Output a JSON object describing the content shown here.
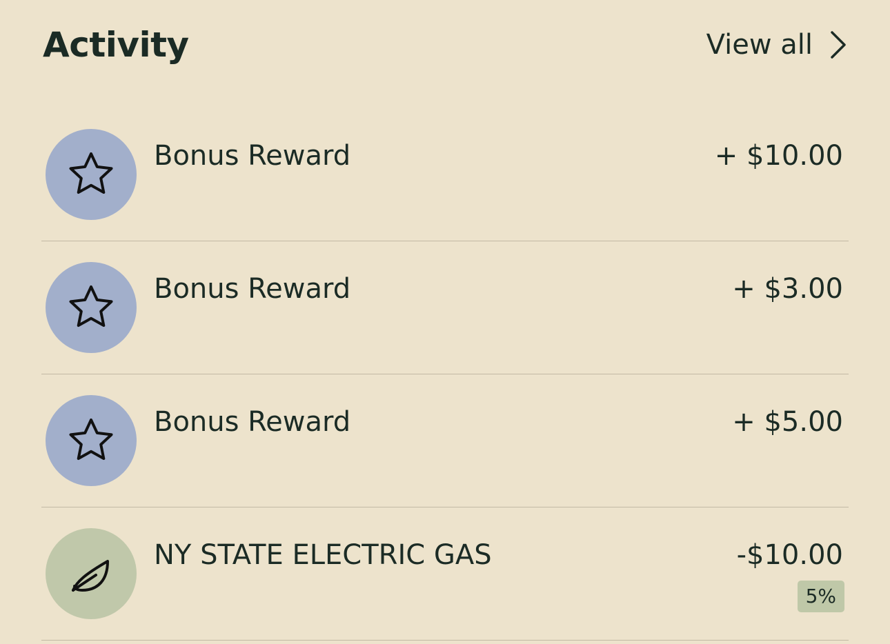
{
  "header": {
    "title": "Activity",
    "view_all_label": "View all"
  },
  "colors": {
    "background": "#ede3cc",
    "text": "#1b2b25",
    "reward_avatar": "#a2afcb",
    "utility_avatar": "#c0c8aa",
    "badge": "#bfc8a8",
    "divider": "#c2b9a4"
  },
  "transactions": [
    {
      "title": "Bonus Reward",
      "amount": "+ $10.00",
      "icon": "star-icon"
    },
    {
      "title": "Bonus Reward",
      "amount": "+ $3.00",
      "icon": "star-icon"
    },
    {
      "title": "Bonus Reward",
      "amount": "+ $5.00",
      "icon": "star-icon"
    },
    {
      "title": "NY STATE ELECTRIC GAS",
      "amount": "-$10.00",
      "badge": "5%",
      "icon": "leaf-icon"
    }
  ]
}
